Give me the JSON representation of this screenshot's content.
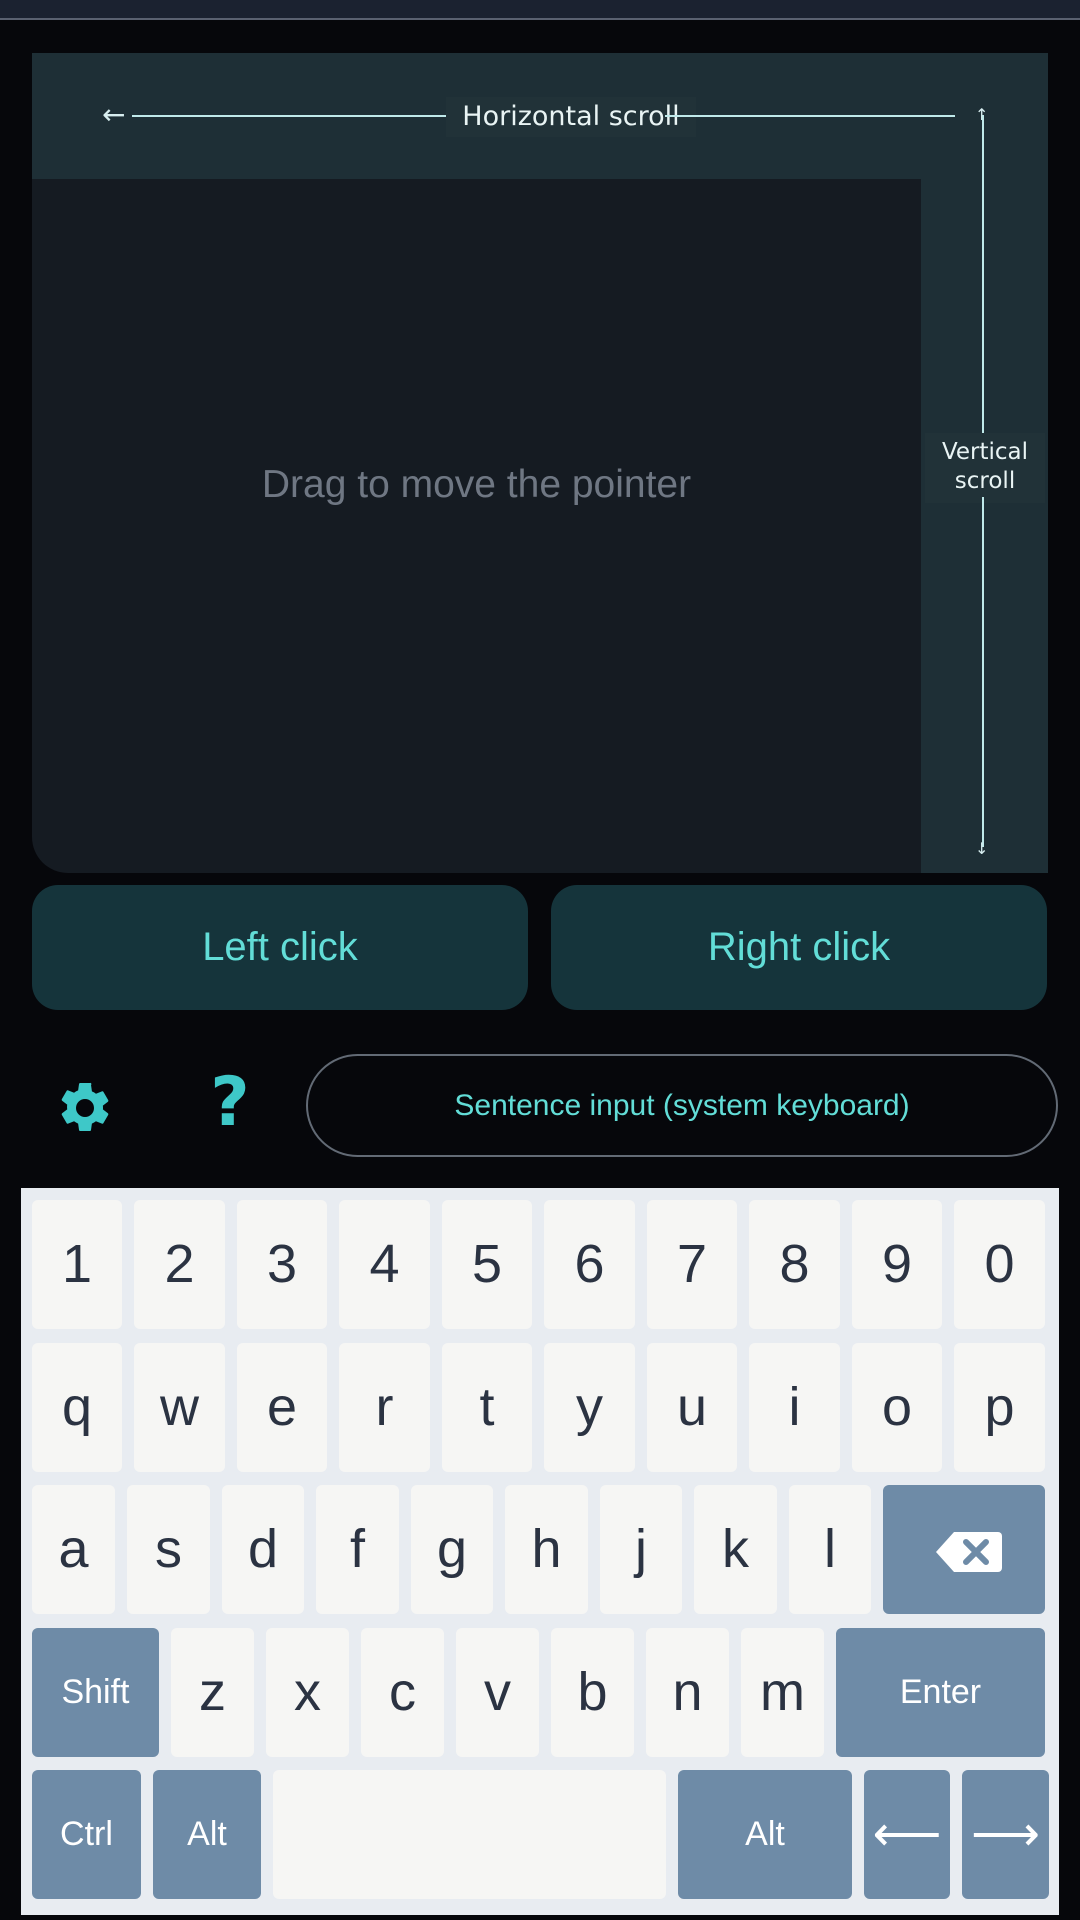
{
  "touchpad": {
    "horizontal_scroll_label": "Horizontal scroll",
    "vertical_scroll_label_line1": "Vertical",
    "vertical_scroll_label_line2": "scroll",
    "hint": "Drag to move the pointer",
    "arrow_left": "←",
    "arrow_up": "↑",
    "arrow_down": "↓"
  },
  "buttons": {
    "left_click": "Left click",
    "right_click": "Right click"
  },
  "toolbar": {
    "settings_icon": "gear-icon",
    "help_label": "?",
    "sentence_input": "Sentence input (system keyboard)"
  },
  "keyboard": {
    "row_numbers": [
      "1",
      "2",
      "3",
      "4",
      "5",
      "6",
      "7",
      "8",
      "9",
      "0"
    ],
    "row_qwerty": [
      "q",
      "w",
      "e",
      "r",
      "t",
      "y",
      "u",
      "i",
      "o",
      "p"
    ],
    "row_asdf": [
      "a",
      "s",
      "d",
      "f",
      "g",
      "h",
      "j",
      "k",
      "l"
    ],
    "row_zxcv": [
      "z",
      "x",
      "c",
      "v",
      "b",
      "n",
      "m"
    ],
    "shift": "Shift",
    "enter": "Enter",
    "ctrl": "Ctrl",
    "alt_left": "Alt",
    "alt_right": "Alt",
    "space": "",
    "arrow_left": "⟵",
    "arrow_right": "⟶",
    "backspace_icon": "backspace-icon"
  },
  "colors": {
    "accent": "#62ddd7",
    "modifier_key": "#6e8ba7",
    "letter_key": "#f6f6f4",
    "background": "#06070b"
  }
}
